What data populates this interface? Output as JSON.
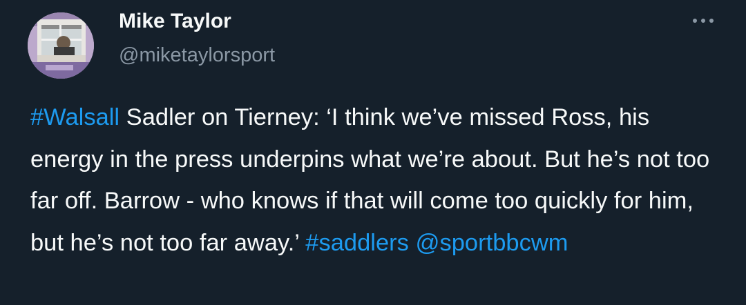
{
  "author": {
    "display_name": "Mike Taylor",
    "handle": "@miketaylorsport"
  },
  "menu": {
    "icon": "more-horizontal-icon"
  },
  "tweet": {
    "hashtag_walsall": "#Walsall",
    "text_main": " Sadler on Tierney: ‘I think we’ve missed Ross, his energy in the press underpins what we’re about. But he’s not too far off. Barrow - who knows if that will come too quickly for him, but he’s not too far away.’ ",
    "hashtag_saddlers": "#saddlers",
    "space": " ",
    "mention": "@sportbbcwm"
  },
  "colors": {
    "background": "#15202b",
    "text": "#f7f9f9",
    "secondary": "#8b98a5",
    "link": "#1d9bf0"
  }
}
